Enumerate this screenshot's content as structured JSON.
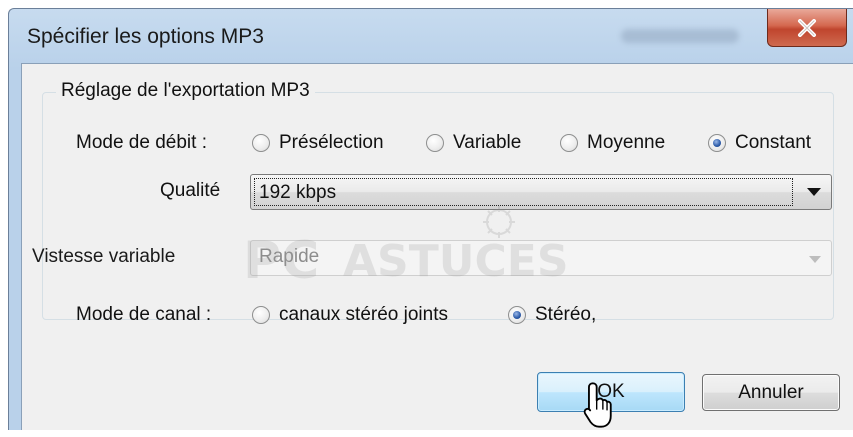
{
  "window": {
    "title": "Spécifier les options MP3",
    "close_label": "close"
  },
  "group": {
    "legend": "Réglage de l'exportation MP3"
  },
  "bitrate_mode": {
    "label": "Mode de débit :",
    "options": [
      {
        "label": "Présélection",
        "checked": false
      },
      {
        "label": "Variable",
        "checked": false
      },
      {
        "label": "Moyenne",
        "checked": false
      },
      {
        "label": "Constant",
        "checked": true
      }
    ]
  },
  "quality": {
    "label": "Qualité",
    "value": "192 kbps"
  },
  "variable_speed": {
    "label": "Vistesse variable",
    "value": "Rapide",
    "disabled": true
  },
  "channel_mode": {
    "label": "Mode de canal :",
    "options": [
      {
        "label": "canaux stéréo joints",
        "checked": false
      },
      {
        "label": "Stéréo,",
        "checked": true
      }
    ]
  },
  "buttons": {
    "ok_label": "OK",
    "cancel_label": "Annuler"
  },
  "watermark": {
    "text_pc": "PC",
    "text_brand": "ASTUCES"
  },
  "colors": {
    "accent_radio": "#2b5aa8",
    "ok_border": "#3c7fb1",
    "close_red": "#c0452e"
  }
}
